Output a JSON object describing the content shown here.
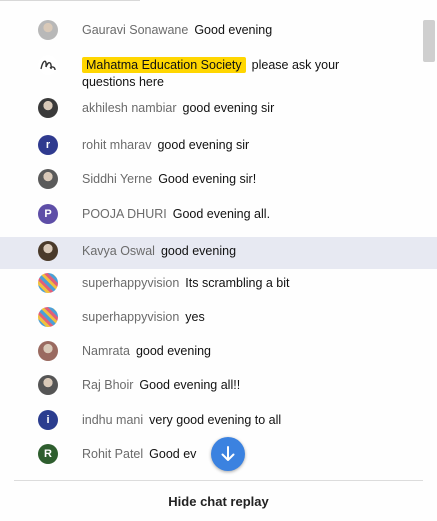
{
  "messages": [
    {
      "author": "Gauravi Sonawane",
      "text": "Good evening",
      "avatar": "photo",
      "color": "#b8b8b8"
    },
    {
      "author": "Mahatma Education Society",
      "text": "please ask your questions here",
      "owner": true,
      "avatar": "logo",
      "color": "#ffffff"
    },
    {
      "author": "akhilesh nambiar",
      "text": "good evening sir",
      "avatar": "photo",
      "color": "#3a3a3a"
    },
    {
      "author": "rohit mharav",
      "text": "good evening sir",
      "avatar": "letter",
      "initial": "r",
      "color": "#2f3a8f"
    },
    {
      "author": "Siddhi Yerne",
      "text": "Good evening sir!",
      "avatar": "photo",
      "color": "#5a5a5a"
    },
    {
      "author": "POOJA DHURI",
      "text": "Good evening all.",
      "avatar": "letter",
      "initial": "P",
      "color": "#5e4ea7"
    },
    {
      "author": "Kavya Oswal",
      "text": "good evening",
      "avatar": "photo",
      "color": "#4a3a2a",
      "highlighted": true
    },
    {
      "author": "superhappyvision",
      "text": "Its scrambling a bit",
      "avatar": "pattern",
      "color": "#e0607a"
    },
    {
      "author": "superhappyvision",
      "text": "yes",
      "avatar": "pattern",
      "color": "#e0607a"
    },
    {
      "author": "Namrata",
      "text": "good evening",
      "avatar": "photo",
      "color": "#9a6a60"
    },
    {
      "author": "Raj Bhoir",
      "text": "Good evening all!!",
      "avatar": "photo",
      "color": "#555555"
    },
    {
      "author": "indhu mani",
      "text": "very good evening to all",
      "avatar": "letter",
      "initial": "i",
      "color": "#2b3d8f"
    },
    {
      "author": "Rohit Patel",
      "text": "Good ev",
      "avatar": "letter",
      "initial": "R",
      "color": "#2e5e2e"
    }
  ],
  "footer": {
    "hide_label": "Hide chat replay"
  },
  "icons": {
    "scroll_down": "arrow-down-icon",
    "more": "more-vert-icon"
  }
}
